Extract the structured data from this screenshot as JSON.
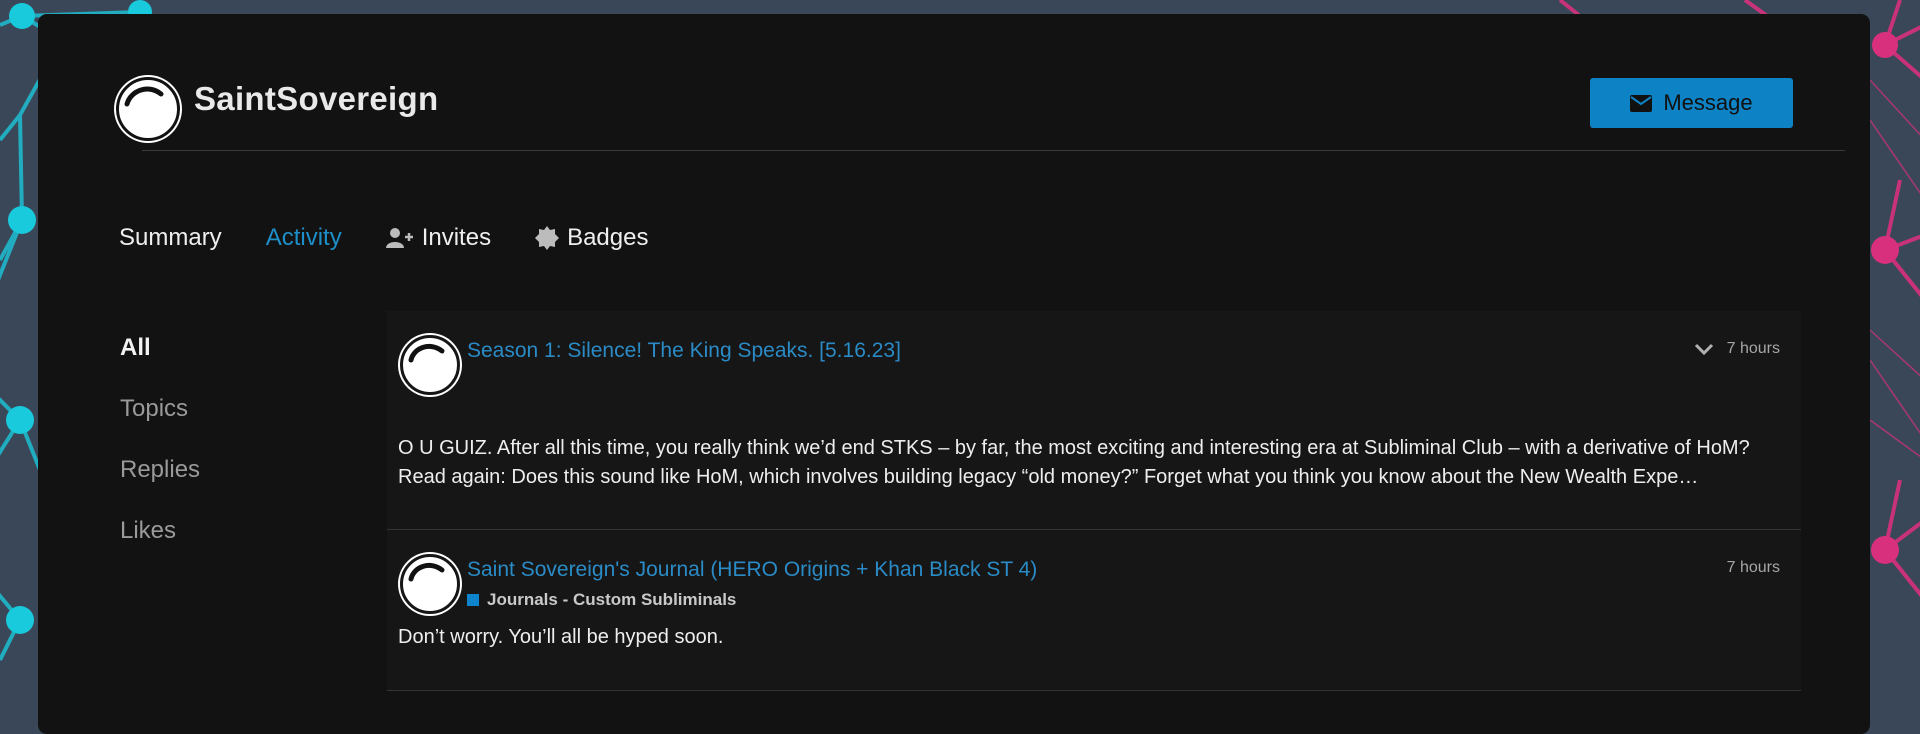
{
  "profile": {
    "username": "SaintSovereign",
    "message_label": "Message"
  },
  "tabs": [
    {
      "label": "Summary",
      "active": false
    },
    {
      "label": "Activity",
      "active": true
    },
    {
      "label": "Invites",
      "icon": "user-plus-icon",
      "active": false
    },
    {
      "label": "Badges",
      "icon": "badge-icon",
      "active": false
    }
  ],
  "sidebar": {
    "items": [
      {
        "label": "All",
        "active": true
      },
      {
        "label": "Topics",
        "active": false
      },
      {
        "label": "Replies",
        "active": false
      },
      {
        "label": "Likes",
        "active": false
      }
    ]
  },
  "posts": [
    {
      "title": "Season 1: Silence! The King Speaks. [5.16.23]",
      "time": "7 hours",
      "excerpt": "O U GUIZ. After all this time, you really think we’d end STKS – by far, the most exciting and interesting era at Subliminal Club – with a derivative of HoM? Read again: Does this sound like HoM, which involves building legacy “old money?” Forget what you think you know about the New Wealth Expe…"
    },
    {
      "title": "Saint Sovereign's Journal (HERO Origins + Khan Black ST 4)",
      "category": "Journals - Custom Subliminals",
      "time": "7 hours",
      "excerpt": "Don’t worry. You’ll all be hyped soon."
    }
  ],
  "colors": {
    "accent": "#0d82c4",
    "link": "#2a8bc6",
    "panel": "#121212",
    "category": "#0e84cc",
    "bg_cyan": "#19c9dc",
    "bg_magenta": "#d8307c"
  }
}
